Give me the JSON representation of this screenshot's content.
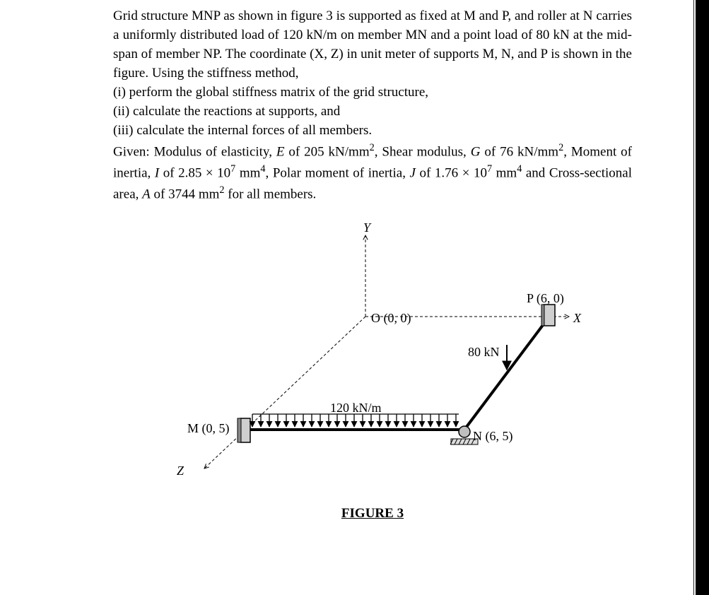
{
  "problem": {
    "para1": "Grid structure MNP as shown in figure 3 is supported as fixed at M and P, and roller at N carries a uniformly distributed load of 120 kN/m on member MN and a point load of 80 kN at the mid-span of member NP. The coordinate (X, Z) in unit meter of supports M, N, and P is shown in the figure. Using the stiffness method,",
    "item_i": "(i)   perform the global stiffness matrix of the grid structure,",
    "item_ii": "(ii)  calculate the reactions at supports, and",
    "item_iii": "(iii) calculate the internal forces of all members.",
    "given_pre": "Given: Modulus of elasticity, ",
    "given_E": "E",
    "given_E_post": " of 205 kN/mm",
    "given_E_unit_sup": "2",
    "given_sep1": ", Shear modulus, ",
    "given_G": "G",
    "given_G_post": " of 76 kN/mm",
    "given_G_unit_sup": "2",
    "given_sep2": ", Moment of inertia, ",
    "given_I": "I",
    "given_I_post": " of 2.85 × 10",
    "given_I_sup": "7",
    "given_I_unit": " mm",
    "given_I_unit_sup": "4",
    "given_sep3": ", Polar moment of inertia, ",
    "given_J": "J",
    "given_J_post": " of 1.76 × 10",
    "given_J_sup": "7",
    "given_J_unit": " mm",
    "given_J_unit_sup": "4",
    "given_sep4": " and Cross-sectional area, ",
    "given_A": "A",
    "given_A_post": " of 3744 mm",
    "given_A_unit_sup": "2",
    "given_tail": " for all members."
  },
  "figure": {
    "caption": "FIGURE 3",
    "labels": {
      "Y": "Y",
      "O": "O (0, 0)",
      "X": "X",
      "P": "P (6, 0)",
      "N": "N (6, 5)",
      "M": "M (0, 5)",
      "Z": "Z",
      "load_udl": "120 kN/m",
      "load_point": "80 kN"
    },
    "nodes": {
      "M": {
        "x": 0,
        "z": 5
      },
      "N": {
        "x": 6,
        "z": 5
      },
      "P": {
        "x": 6,
        "z": 0
      },
      "O": {
        "x": 0,
        "z": 0
      }
    },
    "loads": {
      "udl_member": "MN",
      "udl_value_kN_per_m": 120,
      "point_member": "NP",
      "point_value_kN": 80,
      "point_position": "mid-span"
    },
    "supports": {
      "M": "fixed",
      "N": "roller",
      "P": "fixed"
    }
  },
  "material": {
    "E_kN_per_mm2": 205,
    "G_kN_per_mm2": 76,
    "I_mm4": 28500000.0,
    "J_mm4": 17600000.0,
    "A_mm2": 3744
  }
}
